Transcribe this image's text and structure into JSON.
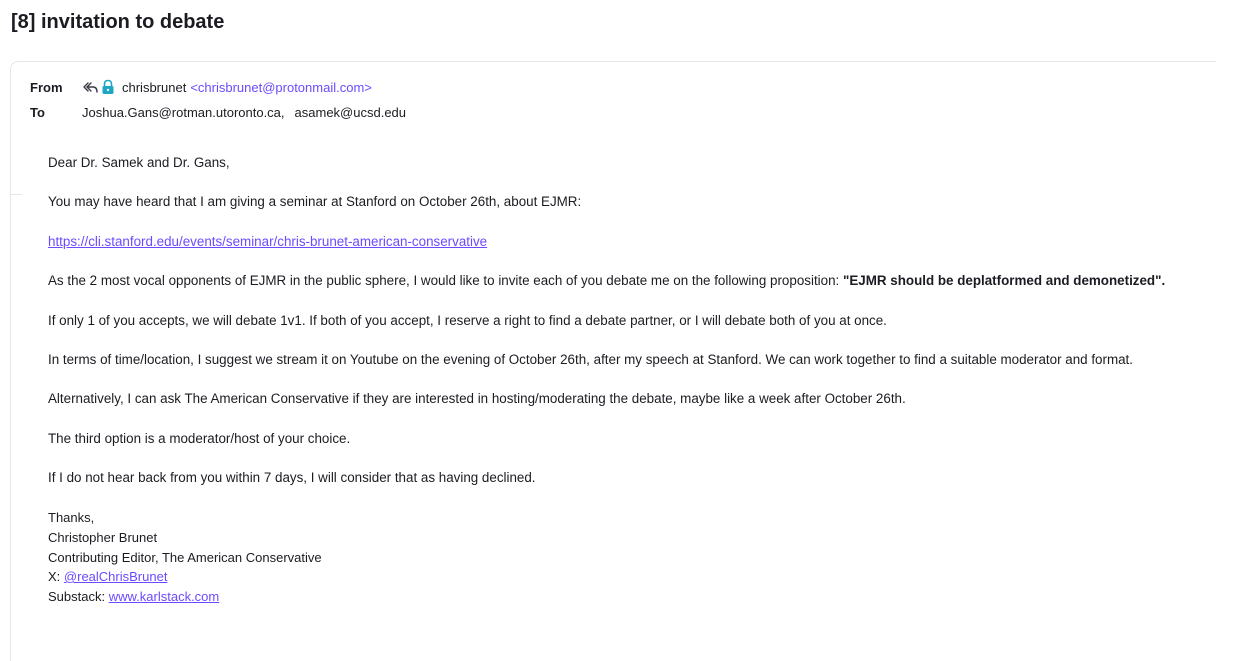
{
  "subject": "[8] invitation to debate",
  "header": {
    "from_label": "From",
    "sender_name": "chrisbrunet",
    "sender_email": "<chrisbrunet@protonmail.com>",
    "to_label": "To",
    "recipients": [
      "Joshua.Gans@rotman.utoronto.ca,",
      "asamek@ucsd.edu"
    ]
  },
  "message": {
    "greeting": "Dear Dr. Samek and Dr. Gans,",
    "p1": "You may have heard that I am giving a seminar at Stanford on October 26th, about EJMR:",
    "link": "https://cli.stanford.edu/events/seminar/chris-brunet-american-conservative",
    "p2_text": "As the 2 most vocal opponents of EJMR in the public sphere, I would like to invite each of you debate me on the following proposition: ",
    "p2_bold": "\"EJMR should be deplatformed and demonetized\".",
    "p3": "If only 1 of you accepts, we will debate 1v1. If both of you accept, I reserve a right to find a debate partner, or I will debate both of you at once.",
    "p4": "In terms of time/location, I suggest we stream it on Youtube on the evening of October 26th, after my speech at Stanford. We can work together to find a suitable moderator and format.",
    "p5": "Alternatively, I can ask The American Conservative if they are interested in hosting/moderating the debate, maybe like a week after October 26th.",
    "p6": "The third option is a moderator/host of your choice.",
    "p7": "If I do not hear back from you within 7 days, I will consider that as having declined."
  },
  "signature": {
    "thanks": "Thanks,",
    "name": "Christopher Brunet",
    "title": "Contributing Editor, The American Conservative",
    "x_label": "X:",
    "x_handle": "@realChrisBrunet",
    "substack_label": "Substack:",
    "substack_link": "www.karlstack.com"
  },
  "colors": {
    "accent": "#6d4aff",
    "lock": "#1ea7c5",
    "text": "#1c1b22"
  },
  "icons": [
    "reply-all-icon",
    "lock-icon"
  ]
}
